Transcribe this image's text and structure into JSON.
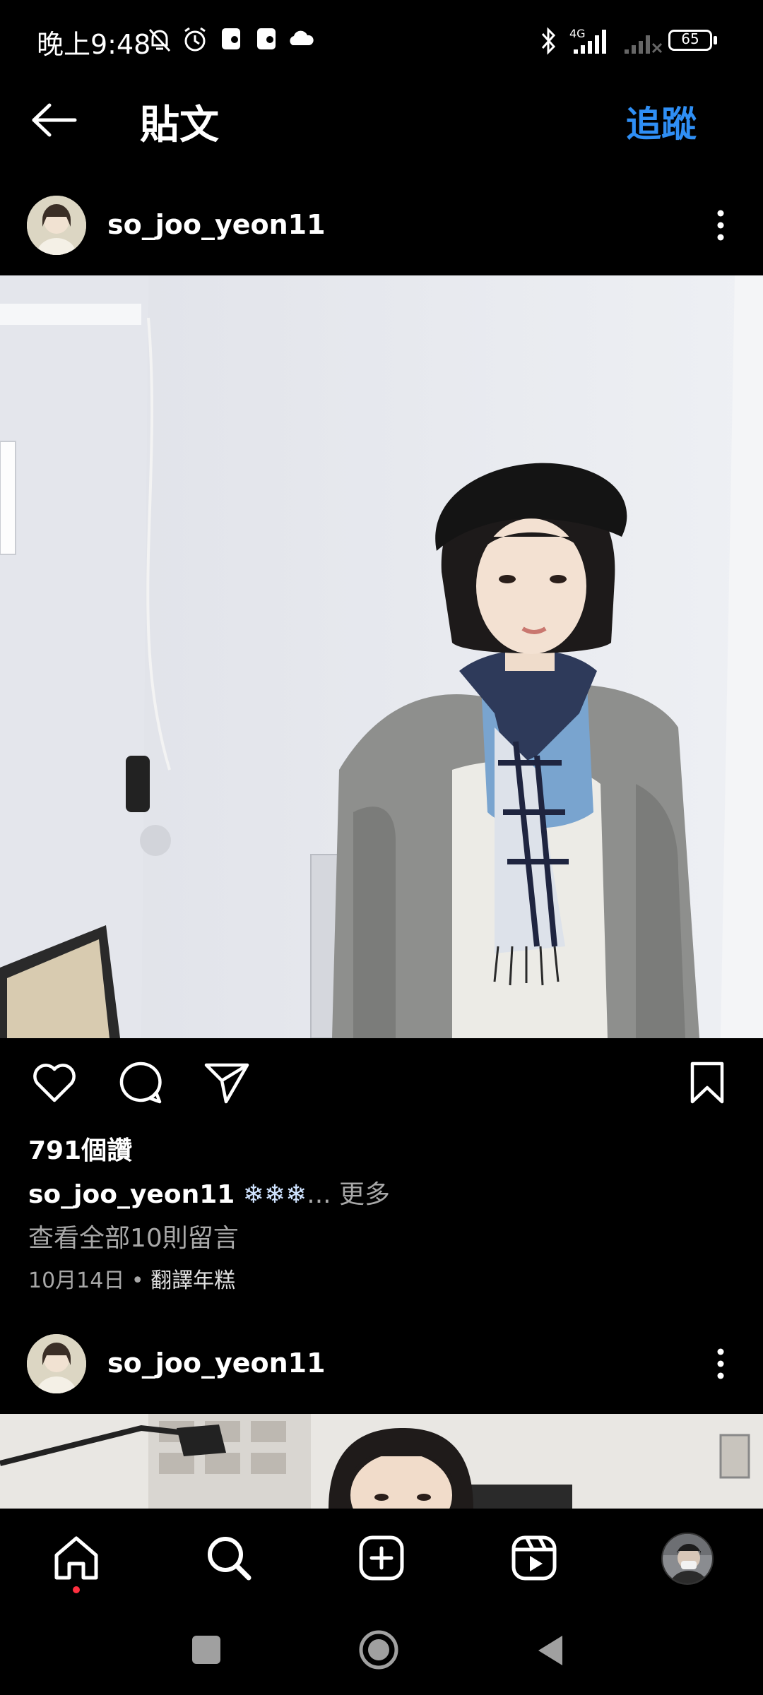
{
  "status_bar": {
    "time": "晚上9:48",
    "network": "4G",
    "battery": "65"
  },
  "header": {
    "title": "貼文",
    "follow_label": "追蹤"
  },
  "post": {
    "username": "so_joo_yeon11",
    "likes": "791個讚",
    "caption_user": "so_joo_yeon11",
    "caption_text": " ❄❄❄",
    "caption_more": "... 更多",
    "view_comments": "查看全部10則留言",
    "date": "10月14日",
    "separator": " • ",
    "translate": "翻譯年糕"
  },
  "post2": {
    "username": "so_joo_yeon11"
  },
  "icons": {
    "back": "arrow-left-icon",
    "more": "more-vertical-icon",
    "like": "heart-icon",
    "comment": "comment-icon",
    "share": "send-icon",
    "save": "bookmark-icon",
    "nav": [
      "home-icon",
      "search-icon",
      "create-icon",
      "reels-icon",
      "profile-avatar"
    ]
  },
  "colors": {
    "accent": "#2f8ff5",
    "notification_dot": "#ff3040",
    "muted_text": "#a8a8a8"
  }
}
